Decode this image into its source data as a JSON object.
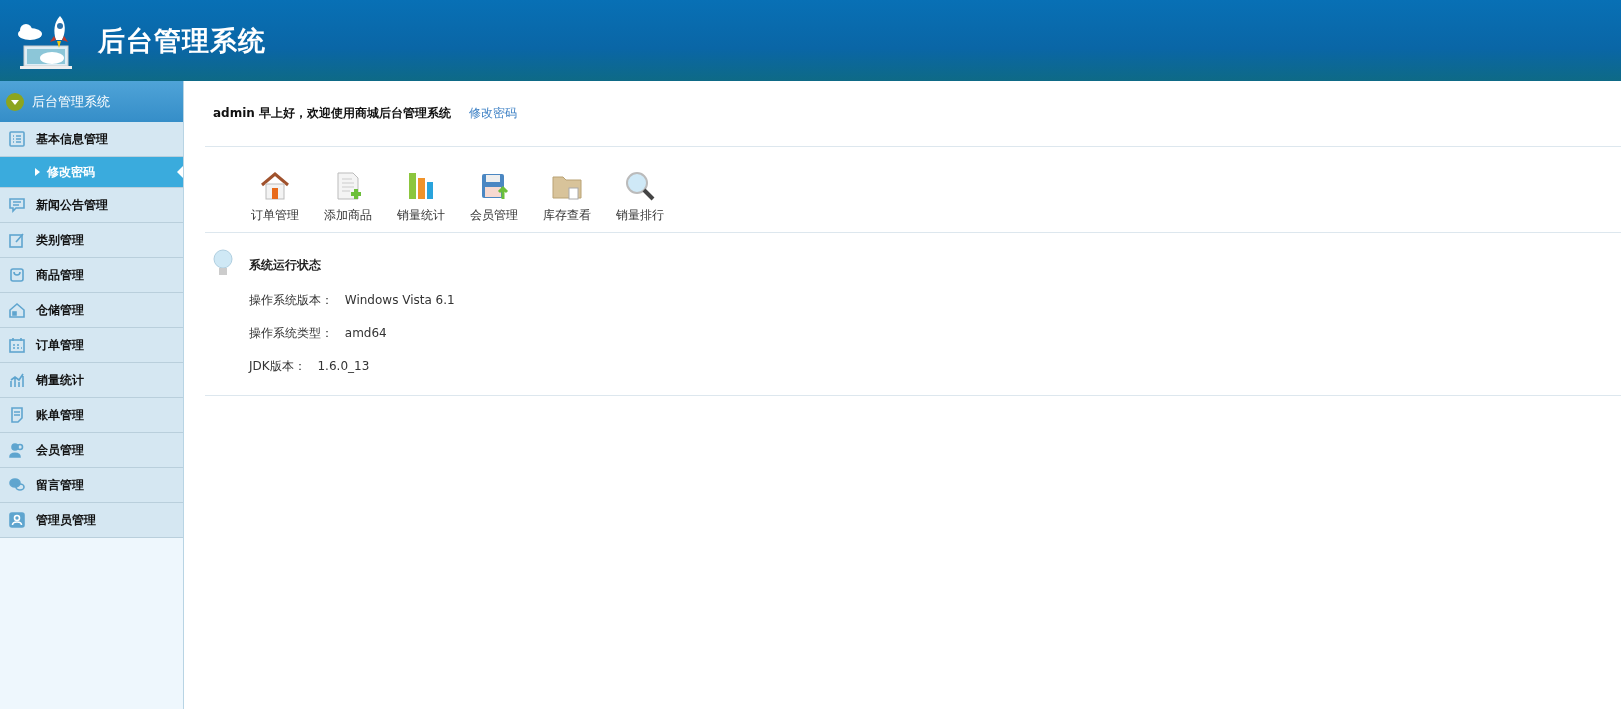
{
  "header": {
    "title": "后台管理系统"
  },
  "sidebar": {
    "title": "后台管理系统",
    "items": [
      {
        "label": "基本信息管理",
        "children": [
          {
            "label": "修改密码",
            "selected": true
          }
        ]
      },
      {
        "label": "新闻公告管理"
      },
      {
        "label": "类别管理"
      },
      {
        "label": "商品管理"
      },
      {
        "label": "仓储管理"
      },
      {
        "label": "订单管理"
      },
      {
        "label": "销量统计"
      },
      {
        "label": "账单管理"
      },
      {
        "label": "会员管理"
      },
      {
        "label": "留言管理"
      },
      {
        "label": "管理员管理"
      }
    ]
  },
  "welcome": {
    "text": "admin 早上好，欢迎使用商城后台管理系统",
    "link": "修改密码"
  },
  "shortcuts": [
    {
      "label": "订单管理"
    },
    {
      "label": "添加商品"
    },
    {
      "label": "销量统计"
    },
    {
      "label": "会员管理"
    },
    {
      "label": "库存查看"
    },
    {
      "label": "销量排行"
    }
  ],
  "status": {
    "title": "系统运行状态",
    "rows": [
      {
        "label": "操作系统版本：",
        "value": "Windows Vista  6.1"
      },
      {
        "label": "操作系统类型：",
        "value": "amd64"
      },
      {
        "label": "JDK版本：",
        "value": "1.6.0_13"
      }
    ]
  }
}
